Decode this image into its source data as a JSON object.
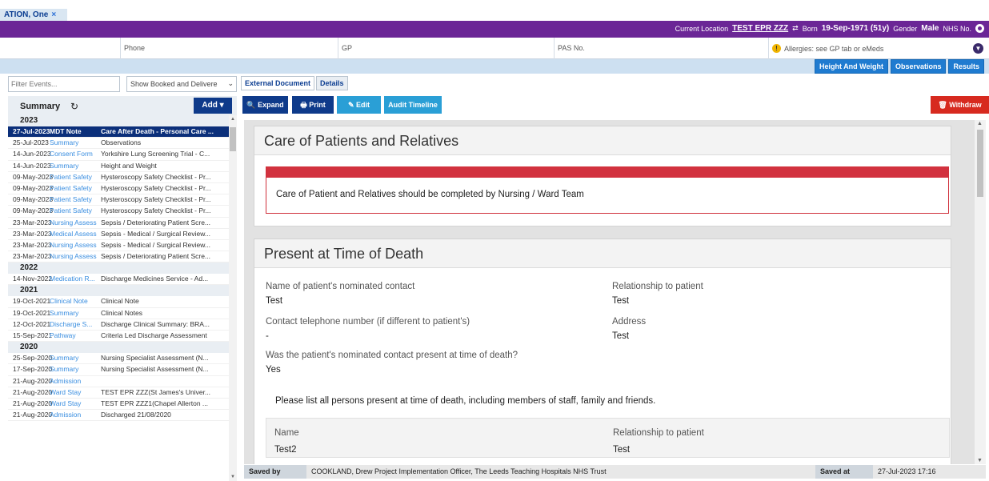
{
  "tab": {
    "label": "ATION, One",
    "close": "×"
  },
  "banner": {
    "current_location_label": "Current Location",
    "current_location": "TEST EPR ZZZ",
    "swap_glyph": "⇄",
    "born_label": "Born",
    "born": "19-Sep-1971 (51y)",
    "gender_label": "Gender",
    "gender": "Male",
    "nhs_label": "NHS No."
  },
  "demographics": {
    "phone": "Phone",
    "gp": "GP",
    "pas": "PAS No.",
    "allergies": "Allergies: see GP tab or eMeds",
    "warn_glyph": "!"
  },
  "band_buttons": [
    "Height And Weight",
    "Observations",
    "Results"
  ],
  "left": {
    "filter_placeholder": "Filter Events...",
    "show_select": "Show Booked and Delivere",
    "select_arrow": "⌄",
    "summary_label": "Summary",
    "refresh_glyph": "↻",
    "add_label": "Add ▾"
  },
  "events": [
    {
      "year": "2023"
    },
    {
      "date": "27-Jul-2023",
      "type": "MDT Note",
      "desc": "Care After Death - Personal Care ...",
      "selected": true
    },
    {
      "date": "25-Jul-2023",
      "type": "Summary",
      "desc": "Observations"
    },
    {
      "date": "14-Jun-2023",
      "type": "Consent Form",
      "desc": "Yorkshire Lung Screening Trial - C..."
    },
    {
      "date": "14-Jun-2023",
      "type": "Summary",
      "desc": "Height and Weight"
    },
    {
      "date": "09-May-2023",
      "type": "Patient Safety",
      "desc": "Hysteroscopy Safety Checklist - Pr..."
    },
    {
      "date": "09-May-2023",
      "type": "Patient Safety",
      "desc": "Hysteroscopy Safety Checklist - Pr..."
    },
    {
      "date": "09-May-2023",
      "type": "Patient Safety",
      "desc": "Hysteroscopy Safety Checklist - Pr..."
    },
    {
      "date": "09-May-2023",
      "type": "Patient Safety",
      "desc": "Hysteroscopy Safety Checklist - Pr..."
    },
    {
      "date": "23-Mar-2023",
      "type": "Nursing Assess",
      "desc": "Sepsis / Deteriorating Patient Scre..."
    },
    {
      "date": "23-Mar-2023",
      "type": "Medical Assess",
      "desc": "Sepsis - Medical / Surgical Review..."
    },
    {
      "date": "23-Mar-2023",
      "type": "Nursing Assess",
      "desc": "Sepsis - Medical / Surgical Review..."
    },
    {
      "date": "23-Mar-2023",
      "type": "Nursing Assess",
      "desc": "Sepsis / Deteriorating Patient Scre..."
    },
    {
      "year": "2022"
    },
    {
      "date": "14-Nov-2022",
      "type": "Medication R...",
      "desc": "Discharge Medicines Service - Ad..."
    },
    {
      "year": "2021"
    },
    {
      "date": "19-Oct-2021",
      "type": "Clinical Note",
      "desc": "Clinical Note"
    },
    {
      "date": "19-Oct-2021",
      "type": "Summary",
      "desc": "Clinical Notes"
    },
    {
      "date": "12-Oct-2021",
      "type": "Discharge S...",
      "desc": "Discharge Clinical Summary: BRA..."
    },
    {
      "date": "15-Sep-2021",
      "type": "Pathway",
      "desc": "Criteria Led Discharge Assessment"
    },
    {
      "year": "2020"
    },
    {
      "date": "25-Sep-2020",
      "type": "Summary",
      "desc": "Nursing Specialist Assessment (N..."
    },
    {
      "date": "17-Sep-2020",
      "type": "Summary",
      "desc": "Nursing Specialist Assessment (N..."
    },
    {
      "date": "21-Aug-2020",
      "type": "Admission",
      "desc": ""
    },
    {
      "date": "21-Aug-2020",
      "type": "Ward Stay",
      "desc": "TEST EPR ZZZ(St James's Univer..."
    },
    {
      "date": "21-Aug-2020",
      "type": "Ward Stay",
      "desc": "TEST EPR ZZZ1(Chapel Allerton ..."
    },
    {
      "date": "21-Aug-2020",
      "type": "Admission",
      "desc": "Discharged 21/08/2020"
    }
  ],
  "doc_tabs": [
    "External Document",
    "Details"
  ],
  "toolbar": {
    "expand": "🔍 Expand",
    "print": "🖶 Print",
    "edit": "✎ Edit",
    "audit": "Audit Timeline",
    "withdraw": "🗑 Withdraw"
  },
  "card1": {
    "title": "Care of Patients and Relatives",
    "alert": "Care of Patient and Relatives should be completed by Nursing / Ward Team"
  },
  "card2": {
    "title": "Present at Time of Death",
    "nominated_label": "Name of patient's nominated contact",
    "nominated_value": "Test",
    "relationship_label": "Relationship to patient",
    "relationship_value": "Test",
    "phone_label": "Contact telephone number (if different to patient's)",
    "phone_value": "-",
    "address_label": "Address",
    "address_value": "Test",
    "present_label": "Was the patient's nominated contact present at time of death?",
    "present_value": "Yes",
    "list_label": "Please list all persons present at time of death, including members of staff, family and friends.",
    "col_name": "Name",
    "col_relationship": "Relationship to patient",
    "row_name": "Test2",
    "row_relationship": "Test"
  },
  "savebar": {
    "saved_by_label": "Saved by",
    "saved_by": "COOKLAND, Drew Project Implementation Officer, The Leeds Teaching Hospitals NHS Trust",
    "saved_at_label": "Saved at",
    "saved_at": "27-Jul-2023 17:16"
  }
}
